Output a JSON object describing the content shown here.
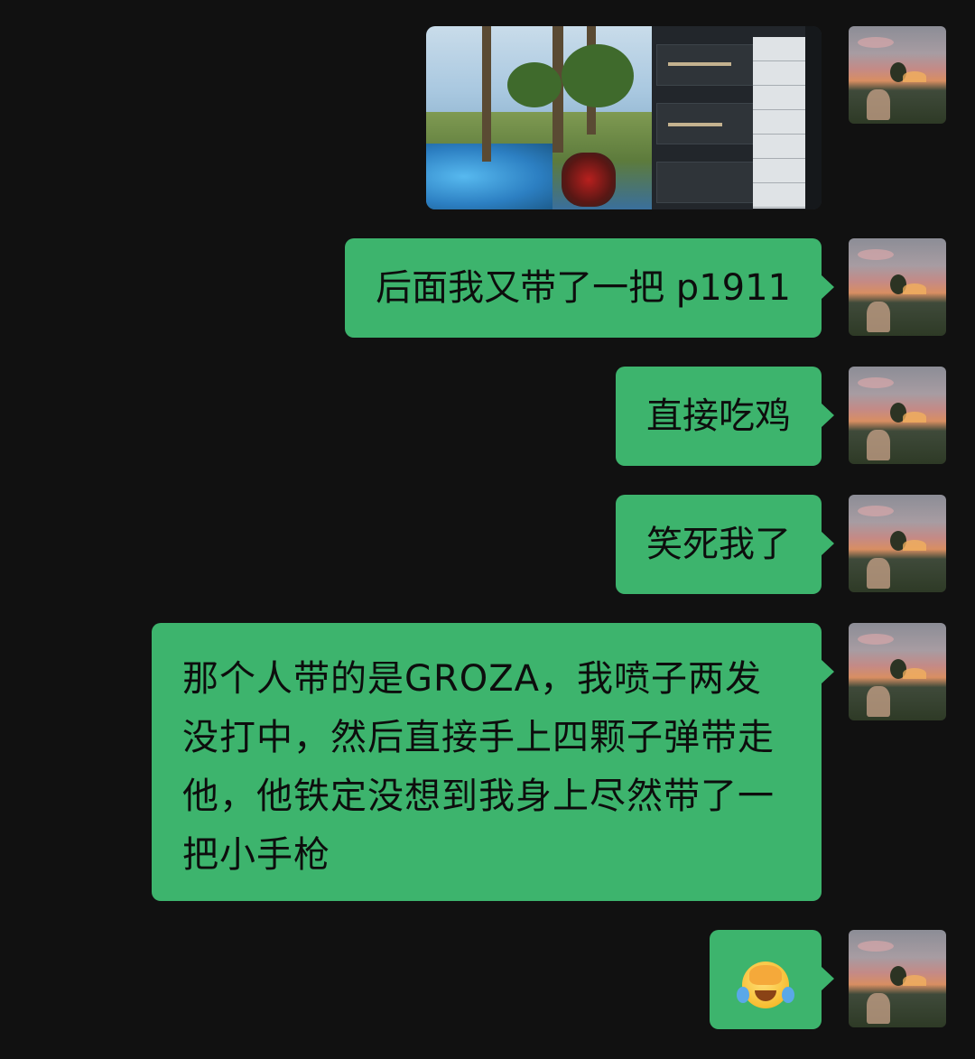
{
  "chat": {
    "messages": [
      {
        "type": "image",
        "sender": "me",
        "content_icon": "game-screenshot"
      },
      {
        "type": "text",
        "sender": "me",
        "text": "后面我又带了一把 p1911"
      },
      {
        "type": "text",
        "sender": "me",
        "text": "直接吃鸡"
      },
      {
        "type": "text",
        "sender": "me",
        "text": "笑死我了"
      },
      {
        "type": "text",
        "sender": "me",
        "text": "那个人带的是GROZA，我喷子两发没打中，然后直接手上四颗子弹带走他，他铁定没想到我身上尽然带了一把小手枪"
      },
      {
        "type": "emoji",
        "sender": "me",
        "icon": "facepalm-laughing-emoji"
      }
    ]
  },
  "colors": {
    "background": "#111111",
    "bubble": "#3db46d",
    "text": "#0d0d0d"
  }
}
